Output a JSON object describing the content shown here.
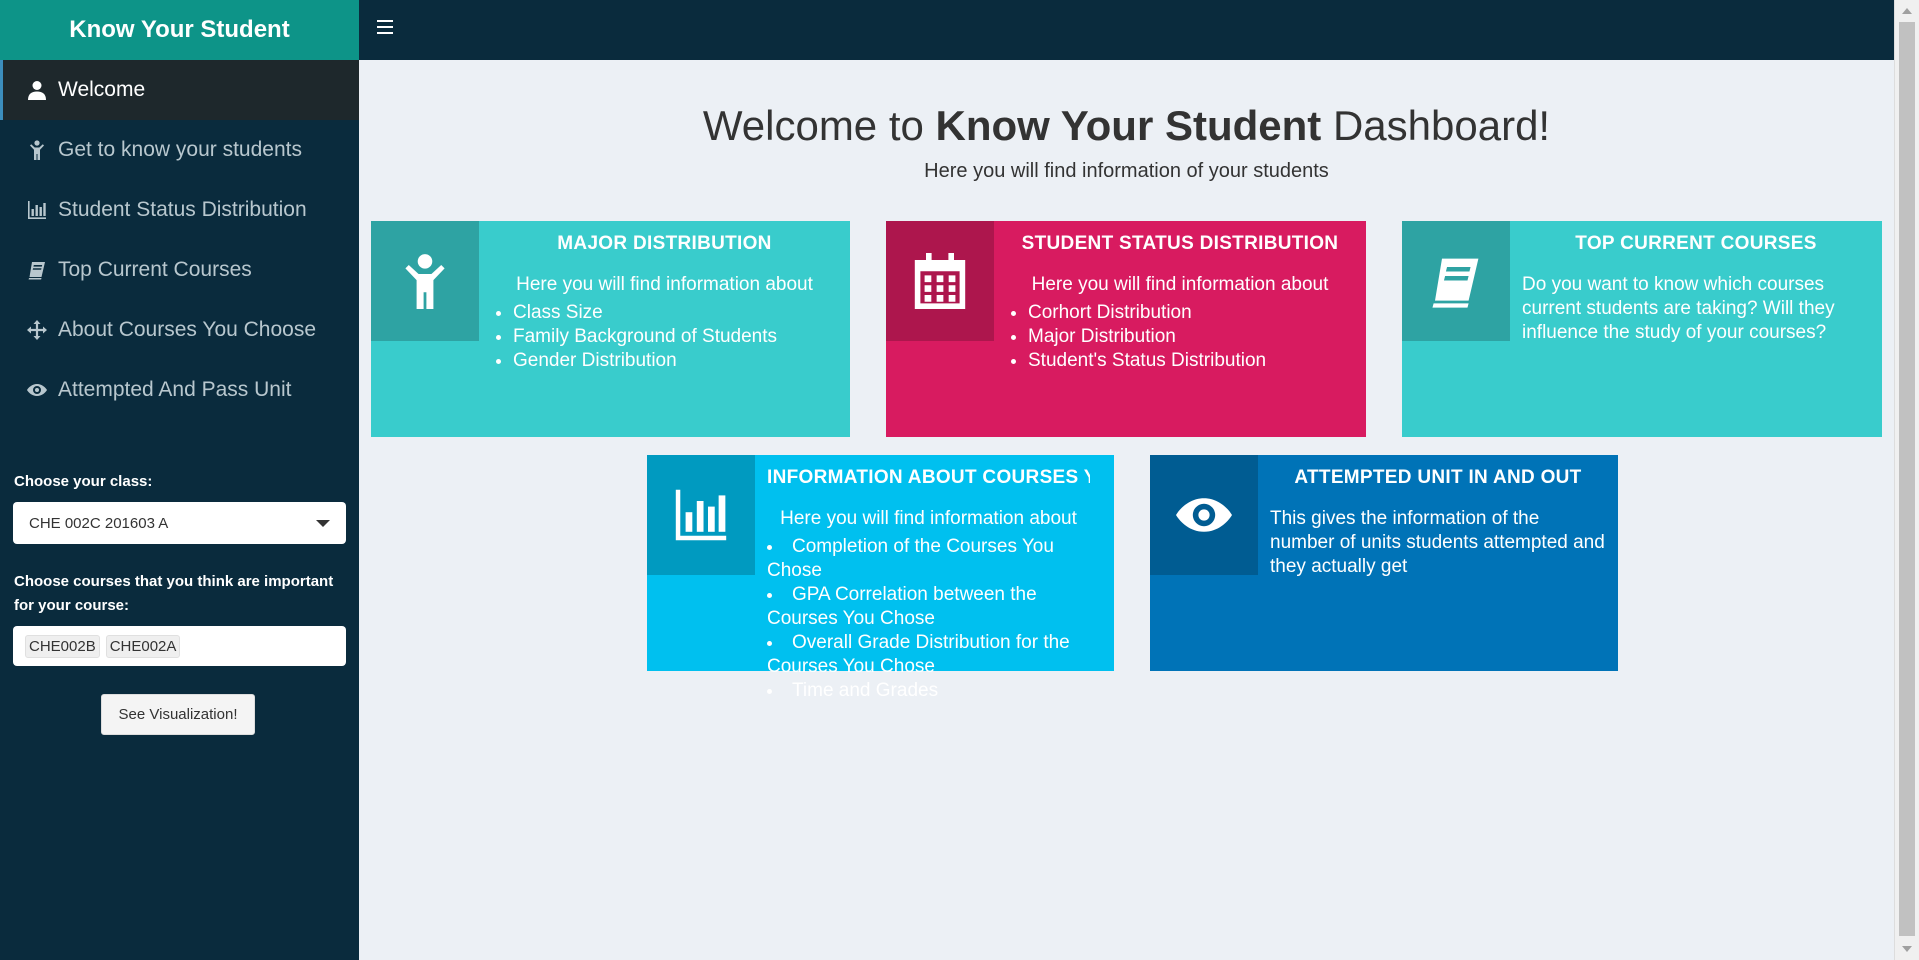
{
  "app": {
    "title": "Know Your Student"
  },
  "sidebar": {
    "items": [
      {
        "label": "Welcome",
        "icon": "user-icon",
        "active": true
      },
      {
        "label": "Get to know your students",
        "icon": "child-icon"
      },
      {
        "label": "Student Status Distribution",
        "icon": "bar-chart-icon"
      },
      {
        "label": "Top Current Courses",
        "icon": "book-icon"
      },
      {
        "label": "About Courses You Choose",
        "icon": "arrows-icon"
      },
      {
        "label": "Attempted And Pass Unit",
        "icon": "eye-icon"
      }
    ],
    "class_label": "Choose your class:",
    "class_value": "CHE 002C 201603 A",
    "courses_label": "Choose courses that you think are important for your course:",
    "courses_selected": [
      "CHE002B",
      "CHE002A"
    ],
    "button_label": "See Visualization!"
  },
  "main": {
    "title_prefix": "Welcome to ",
    "title_bold": "Know Your Student",
    "title_suffix": " Dashboard!",
    "subtitle": "Here you will find information of your students",
    "cards": [
      {
        "title": "MAJOR DISTRIBUTION",
        "intro": "Here you will find information about",
        "items": [
          "Class Size",
          "Family Background of Students",
          "Gender Distribution"
        ],
        "icon": "child-icon",
        "color": "#39cccc"
      },
      {
        "title": "STUDENT STATUS DISTRIBUTION",
        "intro": "Here you will find information about",
        "items": [
          "Corhort Distribution",
          "Major Distribution",
          "Student's Status Distribution"
        ],
        "icon": "calendar-icon",
        "color": "#d81b60"
      },
      {
        "title": "TOP CURRENT COURSES",
        "text": "Do you want to know which courses current students are taking? Will they influence the study of your courses?",
        "icon": "book-icon",
        "color": "#39cccc"
      },
      {
        "title": "INFORMATION ABOUT COURSES YOU CHOOSE",
        "intro": "Here you will find information about",
        "items": [
          "Completion of the Courses You Chose",
          "GPA Correlation between the Courses You Chose",
          "Overall Grade Distribution for the Courses You Chose",
          "Time and Grades"
        ],
        "icon": "bar-chart-icon",
        "color": "#00c0ef"
      },
      {
        "title": "ATTEMPTED UNIT IN AND OUT",
        "text": "This gives the information of the number of units students attempted and they actually get",
        "icon": "eye-icon",
        "color": "#0073b7"
      }
    ]
  }
}
